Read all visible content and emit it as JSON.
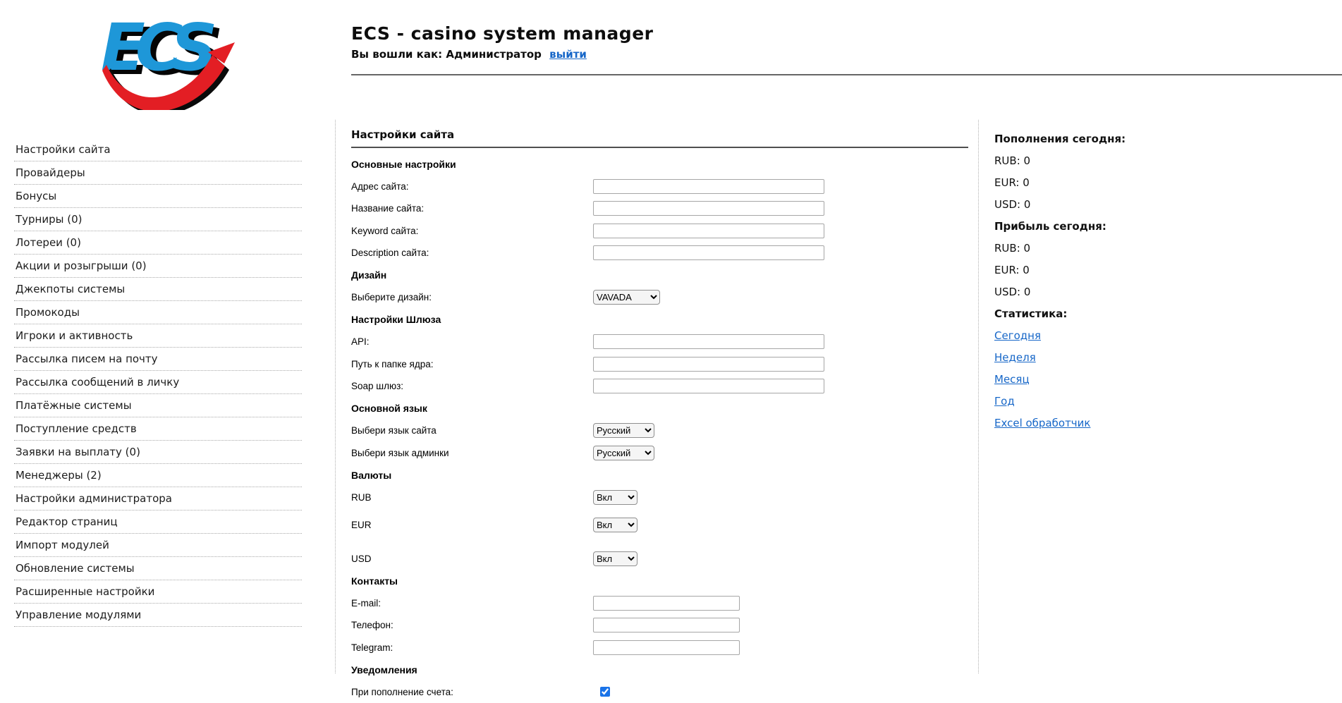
{
  "colors": {
    "link_blue": "#1767c8",
    "logo_blue": "#1e97d8",
    "logo_red": "#e31e24",
    "checkbox_blue": "#1a73e8"
  },
  "header": {
    "logo_text": "ECS",
    "title": "ECS - casino system manager",
    "login_prefix": "Вы вошли как: Администратор",
    "logout_link": "выйти"
  },
  "sidebar": {
    "items": [
      "Настройки сайта",
      "Провайдеры",
      "Бонусы",
      "Турниры (0)",
      "Лотереи (0)",
      "Акции и розыгрыши (0)",
      "Джекпоты системы",
      "Промокоды",
      "Игроки и активность",
      "Рассылка писем на почту",
      "Рассылка сообщений в личку",
      "Платёжные системы",
      "Поступление средств",
      "Заявки на выплату (0)",
      "Менеджеры (2)",
      "Настройки администратора",
      "Редактор страниц",
      "Импорт модулей",
      "Обновление системы",
      "Расширенные настройки",
      "Управление модулями"
    ]
  },
  "main": {
    "title": "Настройки сайта",
    "rows": [
      {
        "kind": "header",
        "label": "Основные настройки"
      },
      {
        "kind": "input",
        "label": "Адрес сайта:",
        "value": ""
      },
      {
        "kind": "input",
        "label": "Название сайта:",
        "value": ""
      },
      {
        "kind": "input",
        "label": "Keyword сайта:",
        "value": ""
      },
      {
        "kind": "input",
        "label": "Description сайта:",
        "value": ""
      },
      {
        "kind": "header",
        "label": "Дизайн"
      },
      {
        "kind": "select",
        "label": "Выберите дизайн:",
        "value": "VAVADA"
      },
      {
        "kind": "header",
        "label": "Настройки Шлюза"
      },
      {
        "kind": "input",
        "label": "API:",
        "value": ""
      },
      {
        "kind": "input",
        "label": "Путь к папке ядра:",
        "value": ""
      },
      {
        "kind": "input",
        "label": "Soap шлюз:",
        "value": ""
      },
      {
        "kind": "header",
        "label": "Основной язык"
      },
      {
        "kind": "select",
        "label": "Выбери язык сайта",
        "value": "Русский"
      },
      {
        "kind": "select",
        "label": "Выбери язык админки",
        "value": "Русский"
      },
      {
        "kind": "header",
        "label": "Валюты"
      },
      {
        "kind": "select",
        "label": "RUB",
        "value": "Вкл"
      },
      {
        "kind": "select",
        "label": "EUR",
        "value": "Вкл"
      },
      {
        "kind": "select",
        "label": "USD",
        "value": "Вкл"
      },
      {
        "kind": "header",
        "label": "Контакты"
      },
      {
        "kind": "input",
        "label": "E-mail:",
        "value": ""
      },
      {
        "kind": "input",
        "label": "Телефон:",
        "value": ""
      },
      {
        "kind": "input",
        "label": "Telegram:",
        "value": ""
      },
      {
        "kind": "header",
        "label": "Уведомления"
      },
      {
        "kind": "checkbox",
        "label": "При пополнение счета:",
        "checked": "checked"
      }
    ]
  },
  "stats": {
    "rows": [
      {
        "kind": "header",
        "text": "Пополнения сегодня:"
      },
      {
        "kind": "value",
        "text": "RUB: 0"
      },
      {
        "kind": "value",
        "text": "EUR: 0"
      },
      {
        "kind": "value",
        "text": "USD: 0"
      },
      {
        "kind": "header",
        "text": "Прибыль сегодня:"
      },
      {
        "kind": "value",
        "text": "RUB: 0"
      },
      {
        "kind": "value",
        "text": "EUR: 0"
      },
      {
        "kind": "value",
        "text": "USD: 0"
      },
      {
        "kind": "header",
        "text": "Статистика:"
      },
      {
        "kind": "link",
        "text": "Сегодня"
      },
      {
        "kind": "link",
        "text": "Неделя"
      },
      {
        "kind": "link",
        "text": "Месяц"
      },
      {
        "kind": "link",
        "text": "Год"
      },
      {
        "kind": "link",
        "text": "Excel обработчик"
      }
    ]
  }
}
